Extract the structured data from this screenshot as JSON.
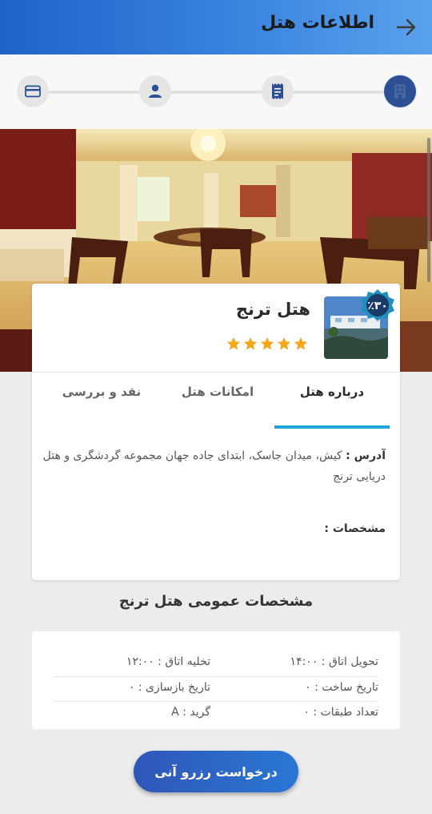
{
  "header": {
    "title": "اطلاعات هتل",
    "back_icon": "arrow-right-icon"
  },
  "stepper": {
    "steps": [
      {
        "icon": "hotel-building-icon",
        "active": true
      },
      {
        "icon": "receipt-icon",
        "active": false
      },
      {
        "icon": "person-icon",
        "active": false
      },
      {
        "icon": "credit-card-icon",
        "active": false
      }
    ]
  },
  "hotel": {
    "name": "هتل ترنج",
    "rating": 5,
    "discount_badge": "٪۳۰",
    "tabs": [
      "درباره هتل",
      "امکانات هتل",
      "نقد و بررسی"
    ],
    "active_tab": 0,
    "address_label": "آدرس :",
    "address_value": "کیش، میدان جاسک، ابتدای جاده جهان مجموعه گردشگری و هتل دریایی ترنج",
    "specs_label": "مشخصات :"
  },
  "general_specs": {
    "title": "مشخصات عمومی هتل ترنج",
    "rows": [
      [
        "تحویل اتاق : ۱۴:۰۰",
        "تخلیه اتاق : ۱۲:۰۰"
      ],
      [
        "تاریخ ساخت : ۰",
        "تاریخ بازسازی : ۰"
      ],
      [
        "تعداد طبقات : ۰",
        "گرید : A"
      ]
    ]
  },
  "reserve_button": "درخواست رزرو آنی",
  "colors": {
    "accent": "#21a3dd",
    "star": "#f4a81c",
    "header": "#2f6fd0"
  }
}
